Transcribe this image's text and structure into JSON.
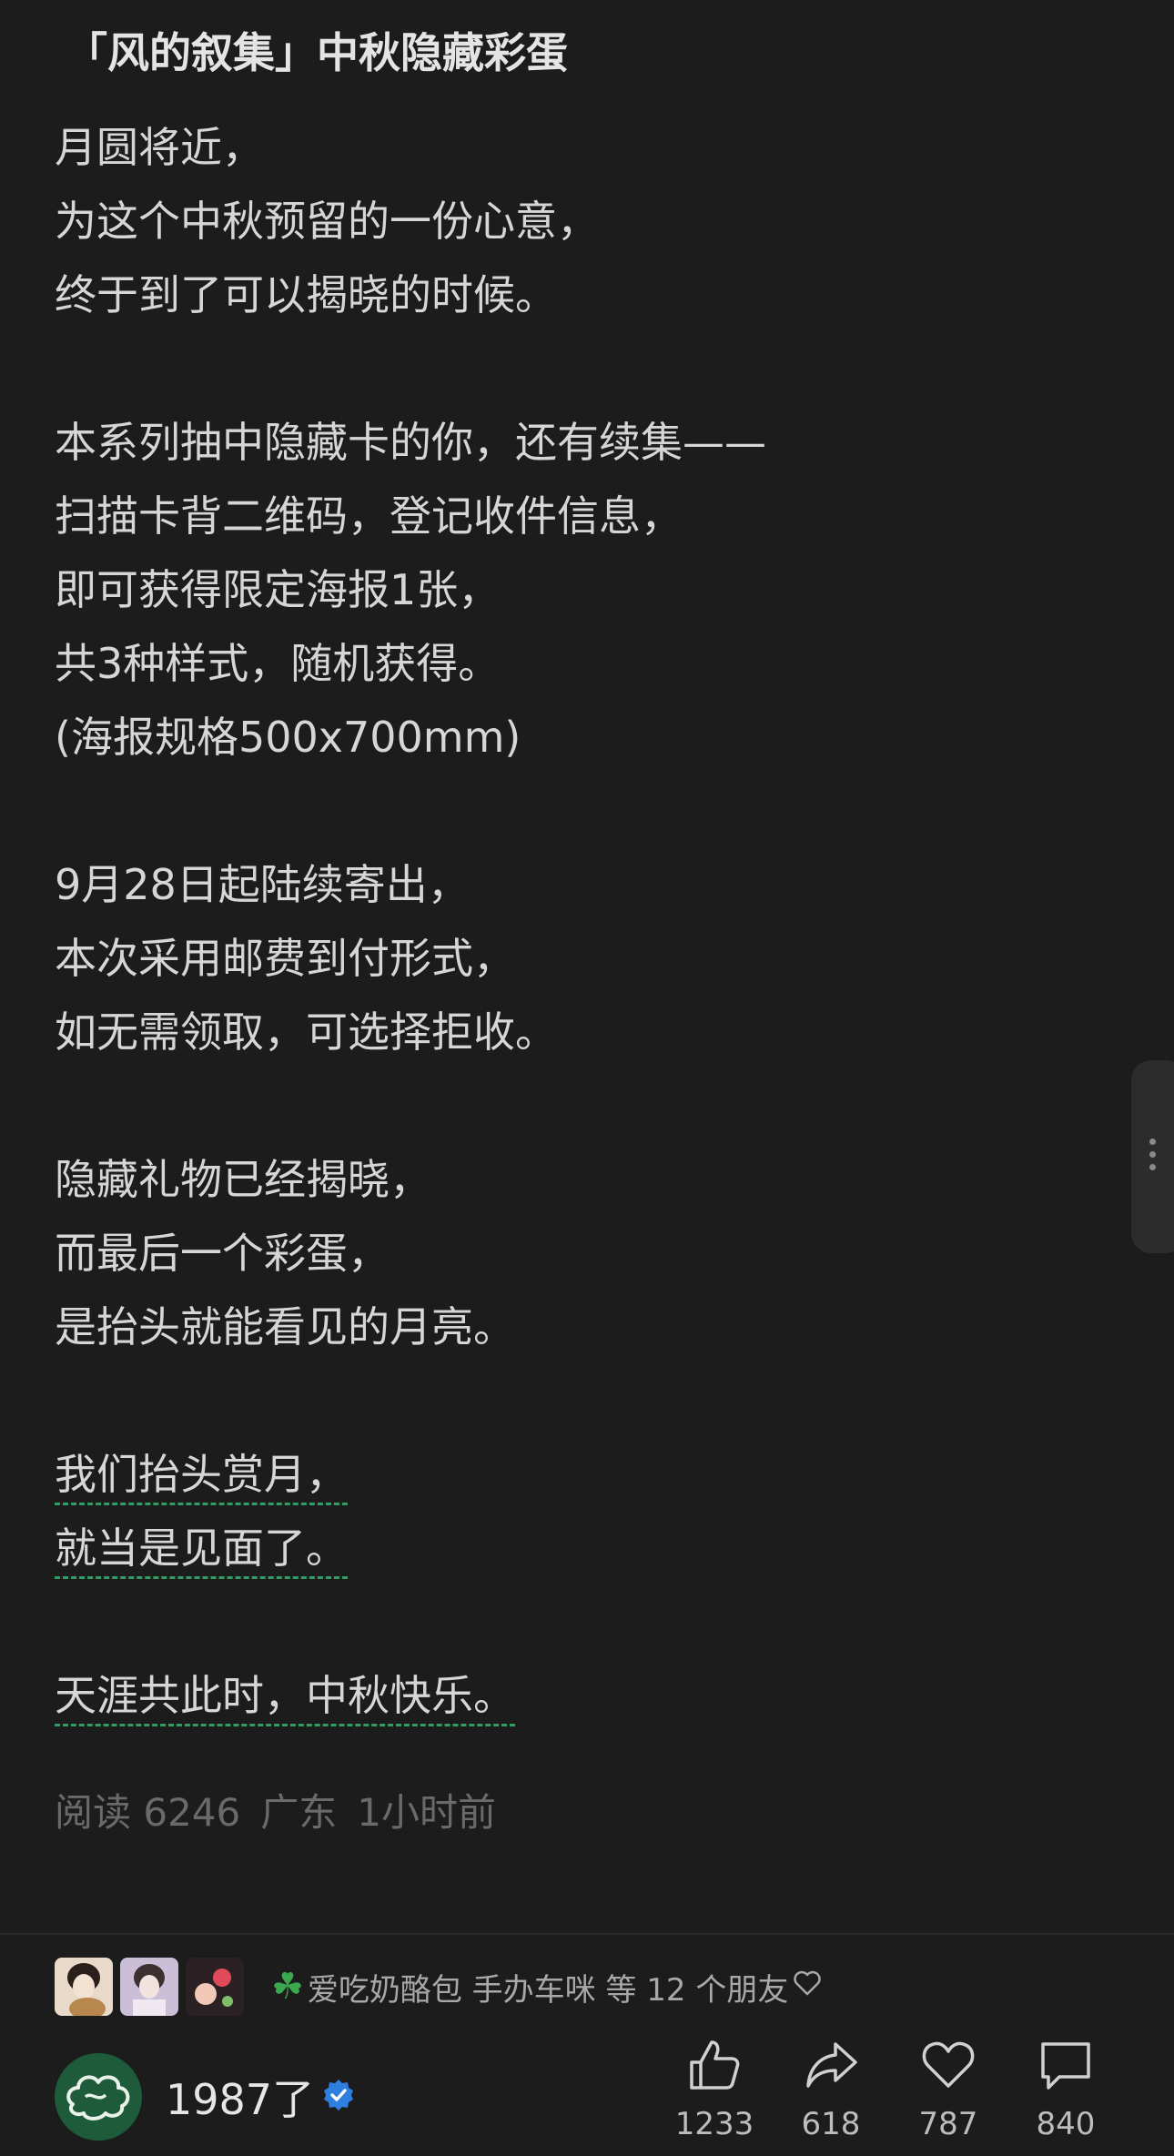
{
  "post": {
    "title": "「风的叙集」中秋隐藏彩蛋",
    "paragraphs": [
      [
        "月圆将近，",
        "为这个中秋预留的一份心意，",
        "终于到了可以揭晓的时候。"
      ],
      [
        "本系列抽中隐藏卡的你，还有续集——",
        "扫描卡背二维码，登记收件信息，",
        "即可获得限定海报1张，",
        "共3种样式，随机获得。",
        "(海报规格500x700mm)"
      ],
      [
        "9月28日起陆续寄出，",
        "本次采用邮费到付形式，",
        "如无需领取，可选择拒收。"
      ],
      [
        "隐藏礼物已经揭晓，",
        "而最后一个彩蛋，",
        "是抬头就能看见的月亮。"
      ],
      [
        "我们抬头赏月，",
        "就当是见面了。"
      ],
      [
        "天涯共此时，中秋快乐。"
      ]
    ],
    "meta": {
      "reads": "阅读 6246",
      "location": "广东",
      "time": "1小时前"
    }
  },
  "friends_liked": {
    "names": "爱吃奶酪包 手办车咪",
    "suffix": "等 12 个朋友",
    "avatars": [
      "friend-avatar-1",
      "friend-avatar-2",
      "friend-avatar-3"
    ]
  },
  "author": {
    "name": "1987了",
    "verified": true
  },
  "actions": {
    "like": "1233",
    "share": "618",
    "favorite": "787",
    "comment": "840"
  },
  "colors": {
    "background": "#1c1c1c",
    "text": "#d6d6d6",
    "meta": "#6a6a6a",
    "dotted_underline": "#2f9e62",
    "verified_badge": "#2f7fe0",
    "author_avatar_bg": "#1e5b3a"
  }
}
